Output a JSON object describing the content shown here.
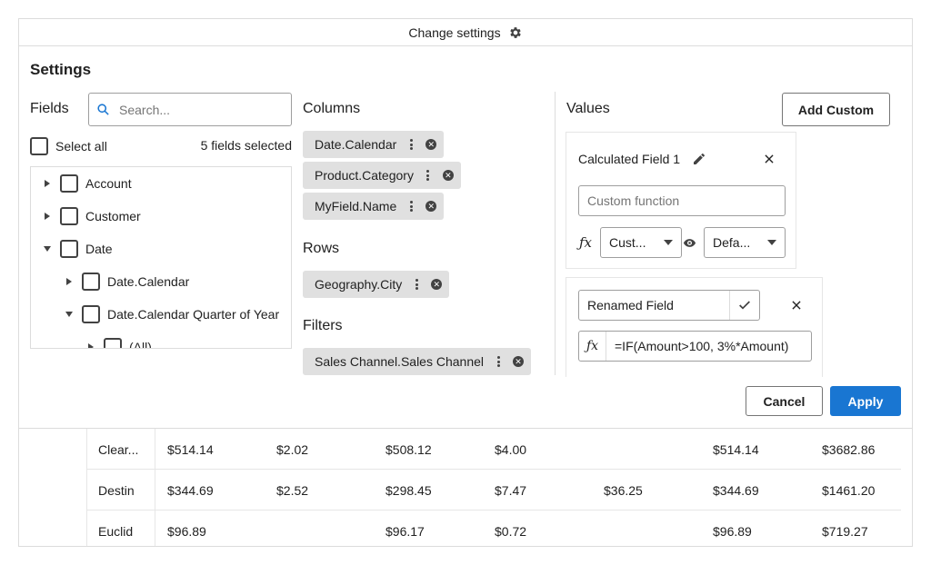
{
  "topbar": {
    "label": "Change settings",
    "icon": "gear-icon"
  },
  "settings": {
    "title": "Settings",
    "fields": {
      "label": "Fields",
      "search_placeholder": "Search...",
      "select_all": "Select all",
      "count": "5 fields selected",
      "tree": [
        {
          "label": "Account",
          "expanded": false
        },
        {
          "label": "Customer",
          "expanded": false
        },
        {
          "label": "Date",
          "expanded": true
        },
        {
          "label": "Date.Calendar",
          "expanded": false
        },
        {
          "label": "Date.Calendar Quarter of Year",
          "expanded": true
        },
        {
          "label": "(All)",
          "expanded": false
        }
      ]
    },
    "columns": {
      "label": "Columns",
      "items": [
        "Date.Calendar",
        "Product.Category",
        "MyField.Name"
      ]
    },
    "rows": {
      "label": "Rows",
      "items": [
        "Geography.City"
      ]
    },
    "filters": {
      "label": "Filters",
      "items": [
        "Sales Channel.Sales Channel"
      ]
    },
    "values": {
      "label": "Values",
      "add_custom": "Add Custom",
      "card1": {
        "name": "Calculated Field 1",
        "function_placeholder": "Custom function",
        "agg": "Cust...",
        "format": "Defa..."
      },
      "card2": {
        "name": "Renamed Field",
        "formula": "=IF(Amount>100, 3%*Amount)"
      }
    },
    "cancel": "Cancel",
    "apply": "Apply"
  },
  "grid": {
    "rows": [
      {
        "label": "Clear...",
        "cells": [
          "$514.14",
          "$2.02",
          "$508.12",
          "$4.00",
          "",
          "$514.14",
          "$3682.86"
        ]
      },
      {
        "label": "Destin",
        "cells": [
          "$344.69",
          "$2.52",
          "$298.45",
          "$7.47",
          "$36.25",
          "$344.69",
          "$1461.20"
        ]
      },
      {
        "label": "Euclid",
        "cells": [
          "$96.89",
          "",
          "$96.17",
          "$0.72",
          "",
          "$96.89",
          "$719.27"
        ]
      }
    ]
  },
  "colors": {
    "primary": "#1976d2",
    "pill": "#e0e0e0",
    "border": "#dcdcdc"
  }
}
